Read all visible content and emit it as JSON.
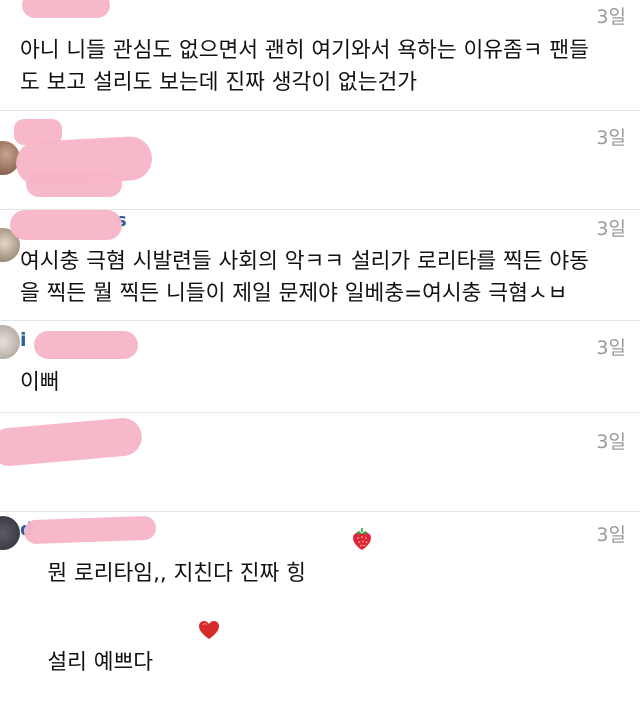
{
  "comments": [
    {
      "timestamp": "3일",
      "text": "아니 니들 관심도 없으면서 괜히 여기와서 욕하는 이유좀ㅋ 팬들\n도 보고 설리도 보는데 진짜 생각이 없는건가"
    },
    {
      "timestamp": "3일",
      "text": ""
    },
    {
      "timestamp": "3일",
      "text": "여시충 극혐 시발련들 사회의 악ㅋㅋ 설리가 로리타를 찍든 야동\n을 찍든 뭘 찍든 니들이 제일 문제야 일베충=여시충 극혐ㅅㅂ"
    },
    {
      "timestamp": "3일",
      "text": "이뻐"
    },
    {
      "timestamp": "3일",
      "text": "뭔 로리타임,, 지친다 진짜 힝",
      "emoji": "strawberry-icon"
    },
    {
      "timestamp": "3일",
      "text": "설리 예쁘다",
      "emoji": "heart-icon"
    }
  ],
  "colors": {
    "username": "#2b5f9e",
    "redaction": "#f7b6c8",
    "timestamp": "#9a9a9a",
    "divider": "#e4e4e6",
    "heart": "#d62b2b",
    "strawberry": "#e0243a"
  }
}
